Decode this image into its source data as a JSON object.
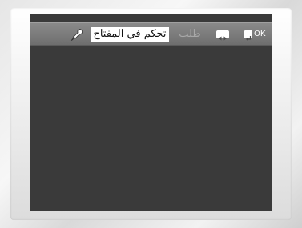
{
  "menu": {
    "field_text": "تحكم في المفتاح",
    "request_label": "طلب",
    "ok_label": "OK"
  },
  "icons": {
    "microphone": "microphone-icon",
    "left_right": "left-right-arrows-icon",
    "enter": "enter-icon"
  },
  "colors": {
    "screen_background": "#3a3a3a",
    "menubar": "#7a7a7a",
    "field_background": "#ffffff",
    "dimmed_text": "#a8a8a8"
  }
}
